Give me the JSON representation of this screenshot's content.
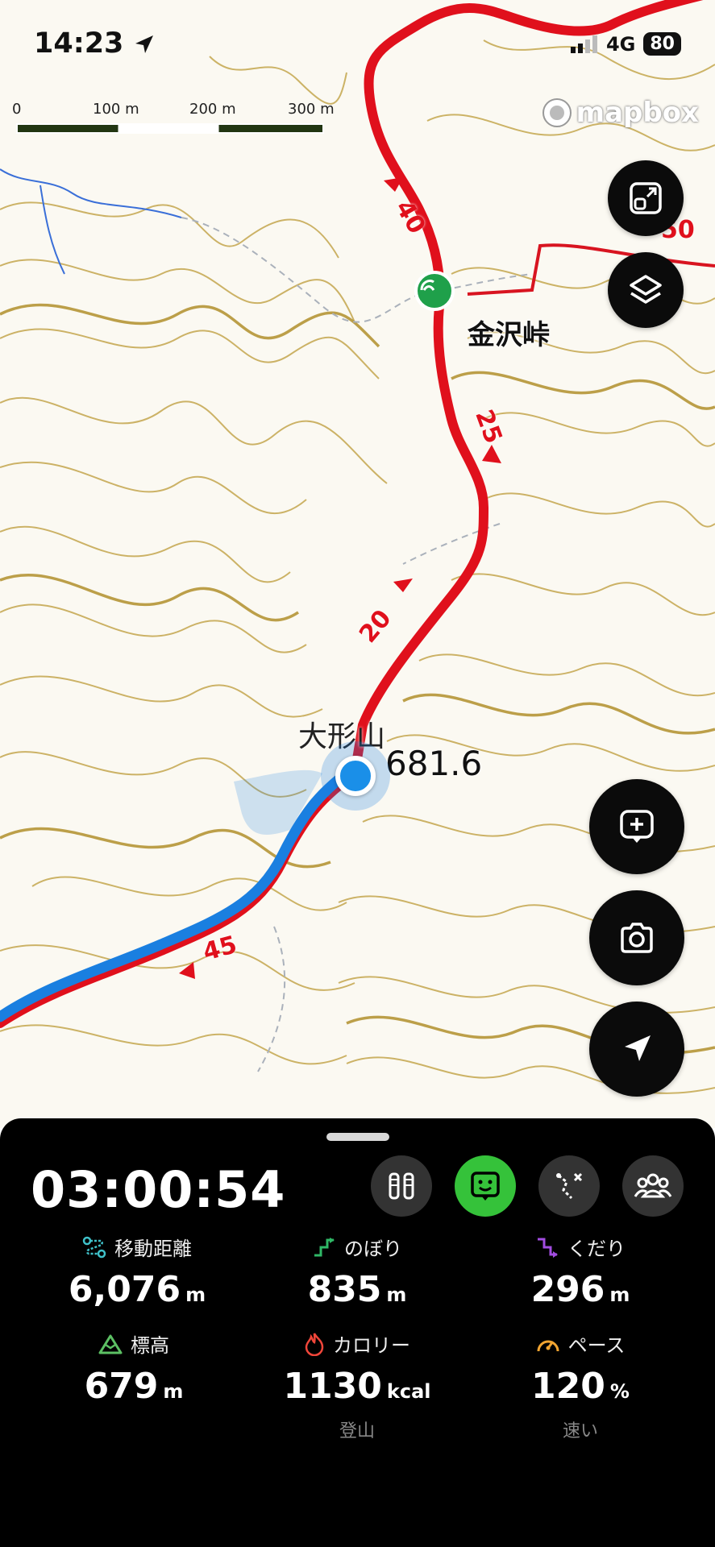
{
  "status": {
    "time": "14:23",
    "network": "4G",
    "battery": "80"
  },
  "map": {
    "scale_labels": [
      "0",
      "100 m",
      "200 m",
      "300 m"
    ],
    "attribution": "mapbox",
    "pass_name": "金沢峠",
    "peak_name": "大形山",
    "peak_elevation": "681.6",
    "route_numbers": [
      "40",
      "25",
      "20",
      "45",
      "50"
    ]
  },
  "buttons": {
    "fit_icon": "fit-screen-icon",
    "layers_icon": "layers-icon",
    "add_icon": "add-note-icon",
    "camera_icon": "camera-icon",
    "locate_icon": "location-arrow-icon"
  },
  "panel": {
    "elapsed": "03:00:54",
    "modes": [
      "hiking-poles-icon",
      "face-icon",
      "route-icon",
      "group-icon"
    ],
    "stats": [
      {
        "label": "移動距離",
        "value": "6,076",
        "unit": "m",
        "sub": "",
        "icon_color": "#3fc1c9"
      },
      {
        "label": "のぼり",
        "value": "835",
        "unit": "m",
        "sub": "",
        "icon_color": "#2fb866"
      },
      {
        "label": "くだり",
        "value": "296",
        "unit": "m",
        "sub": "",
        "icon_color": "#a24de0"
      },
      {
        "label": "標高",
        "value": "679",
        "unit": "m",
        "sub": "",
        "icon_color": "#5cc063"
      },
      {
        "label": "カロリー",
        "value": "1130",
        "unit": "kcal",
        "sub": "登山",
        "icon_color": "#f0463a"
      },
      {
        "label": "ペース",
        "value": "120",
        "unit": "%",
        "sub": "速い",
        "icon_color": "#f2a531"
      }
    ]
  },
  "colors": {
    "route_red": "#e0101c",
    "track_blue": "#1a7fe0",
    "contour": "#b89a3a",
    "panel_bg": "#000000",
    "mode_active": "#35c23a"
  }
}
